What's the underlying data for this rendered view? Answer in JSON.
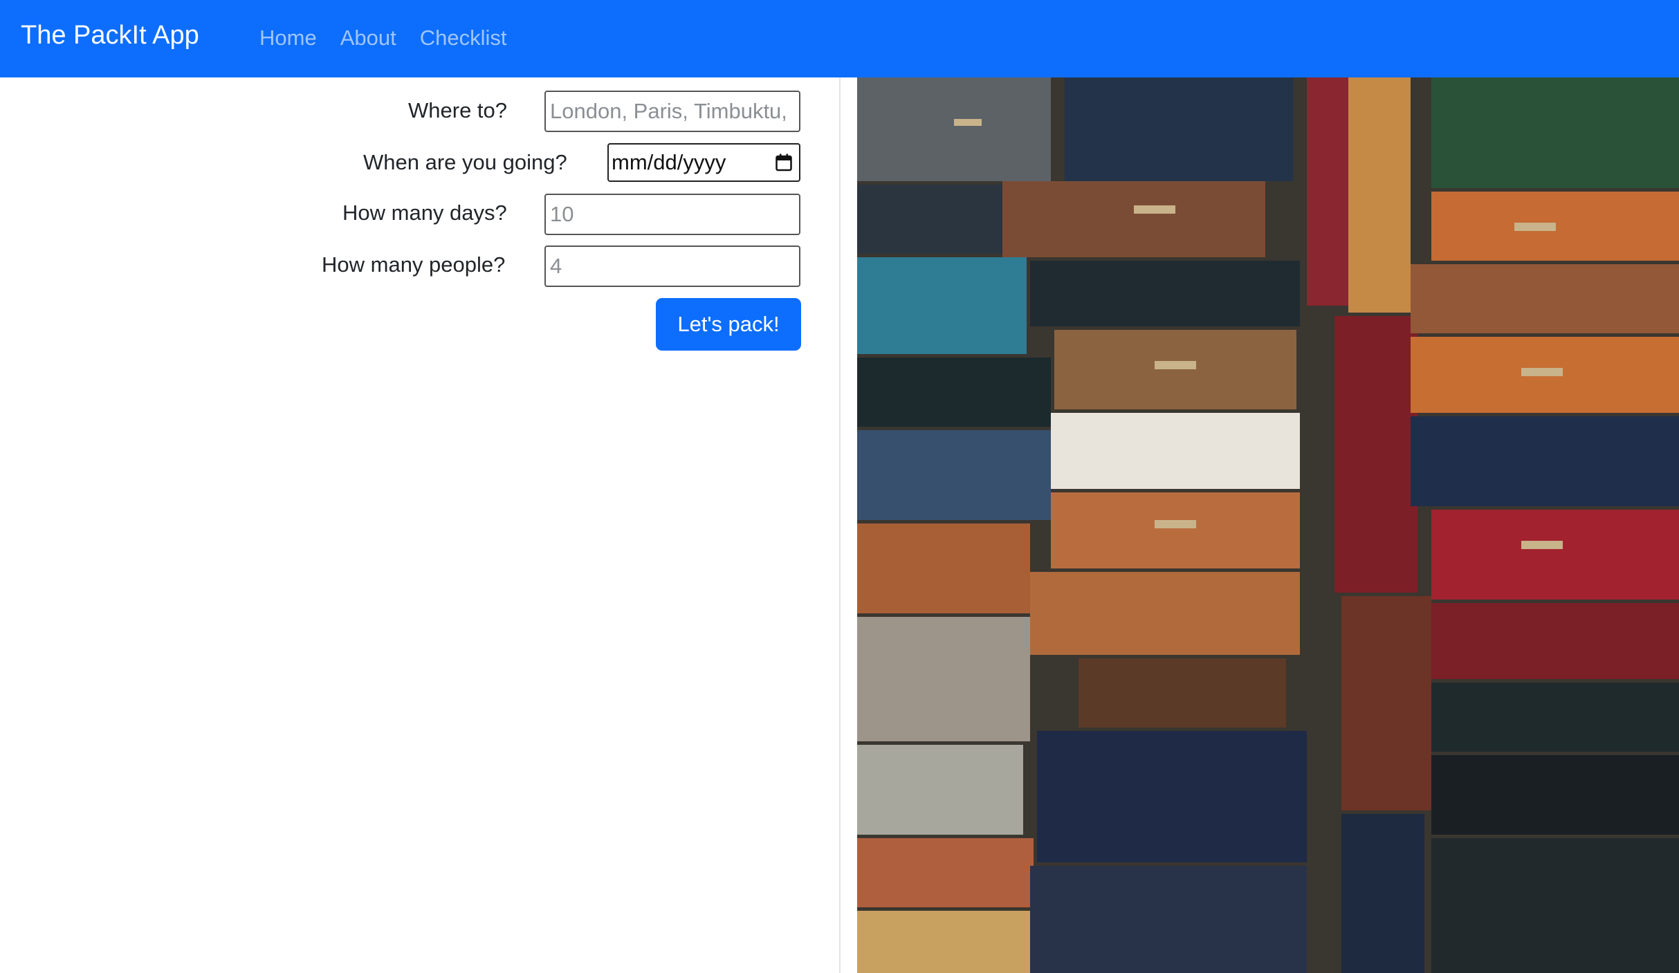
{
  "navbar": {
    "brand": "The PackIt App",
    "links": [
      "Home",
      "About",
      "Checklist"
    ],
    "color": "#0d6efd"
  },
  "form": {
    "destination": {
      "label": "Where to?",
      "placeholder": "London, Paris, Timbuktu, ..."
    },
    "date": {
      "label": "When are you going?",
      "value": "mm/dd/yyyy"
    },
    "days": {
      "label": "How many days?",
      "placeholder": "10"
    },
    "people": {
      "label": "How many people?",
      "placeholder": "4"
    },
    "submit_label": "Let's pack!"
  },
  "image": {
    "subject": "stacks of vintage suitcases"
  }
}
